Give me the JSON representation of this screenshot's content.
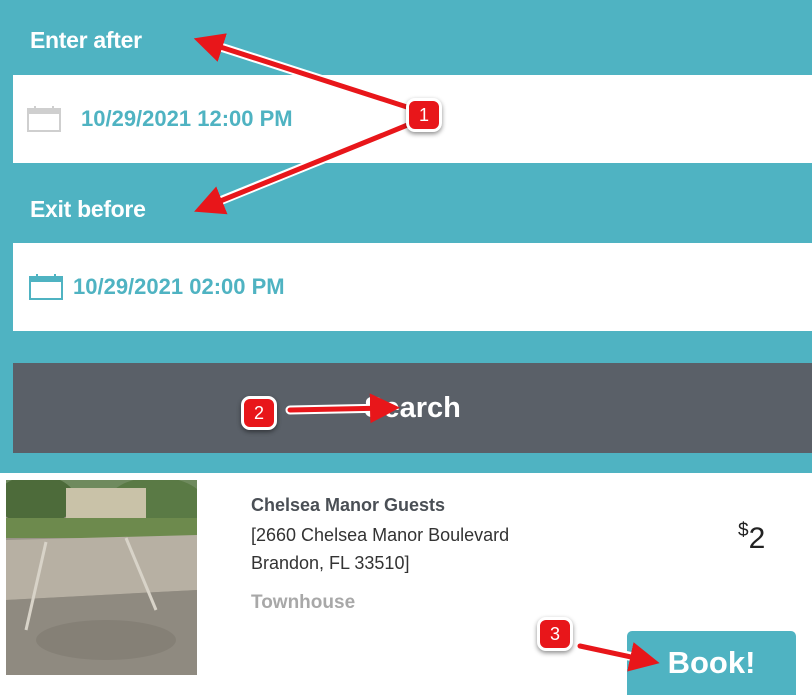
{
  "form": {
    "enter_label": "Enter after",
    "enter_value": "10/29/2021 12:00 PM",
    "exit_label": "Exit before",
    "exit_value": "10/29/2021 02:00 PM",
    "search_label": "Search"
  },
  "listing": {
    "name": "Chelsea Manor Guests",
    "address_line1": "[2660 Chelsea Manor Boulevard",
    "address_line2": "Brandon, FL 33510]",
    "type": "Townhouse",
    "price_currency": "$",
    "price_value": "2",
    "book_label": "Book!"
  },
  "annotations": {
    "badge1": "1",
    "badge2": "2",
    "badge3": "3"
  },
  "colors": {
    "accent": "#4fb3c2",
    "search_button": "#5a6068",
    "annotation_red": "#e8161a"
  },
  "icons": [
    "calendar-icon"
  ]
}
